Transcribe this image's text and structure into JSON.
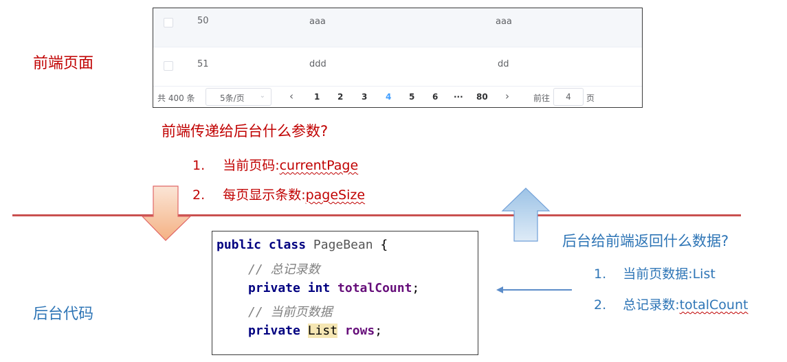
{
  "table": {
    "rows": [
      {
        "id": "50",
        "col2": "aaa",
        "col3": "aaa"
      },
      {
        "id": "51",
        "col2": "ddd",
        "col3": "dd"
      }
    ],
    "pagination": {
      "total": "共 400 条",
      "page_size": "5条/页",
      "prev": "‹",
      "pages": [
        "1",
        "2",
        "3",
        "4",
        "5",
        "6",
        "···",
        "80"
      ],
      "active_page": "4",
      "next": "›",
      "goto_prefix": "前往",
      "goto_value": "4",
      "goto_suffix": "页"
    }
  },
  "labels": {
    "frontend": "前端页面",
    "backend": "后台代码"
  },
  "request": {
    "heading": "前端传递给后台什么参数?",
    "items": [
      {
        "num": "1.",
        "text": "当前页码:",
        "param": "currentPage"
      },
      {
        "num": "2.",
        "text": "每页显示条数:",
        "param": "pageSize"
      }
    ]
  },
  "response": {
    "heading": "后台给前端返回什么数据?",
    "items": [
      {
        "num": "1.",
        "text": "当前页数据:",
        "param": "List"
      },
      {
        "num": "2.",
        "text": "总记录数:",
        "param": "totalCount"
      }
    ]
  },
  "code": {
    "line1": {
      "kw": "public class ",
      "cls": "PageBean",
      "rest": " {"
    },
    "comment1": "// 总记录数",
    "line3": {
      "kw": "private int ",
      "field": "totalCount",
      "rest": ";"
    },
    "comment2": "// 当前页数据",
    "line5": {
      "kw": "private ",
      "type": "List",
      "field": "rows",
      "rest": ";"
    }
  },
  "colors": {
    "red": "#c00000",
    "blue": "#2e75b6",
    "down_arrow": "#f4b183",
    "up_arrow": "#9dc3e6",
    "divider": "#c9504f"
  }
}
